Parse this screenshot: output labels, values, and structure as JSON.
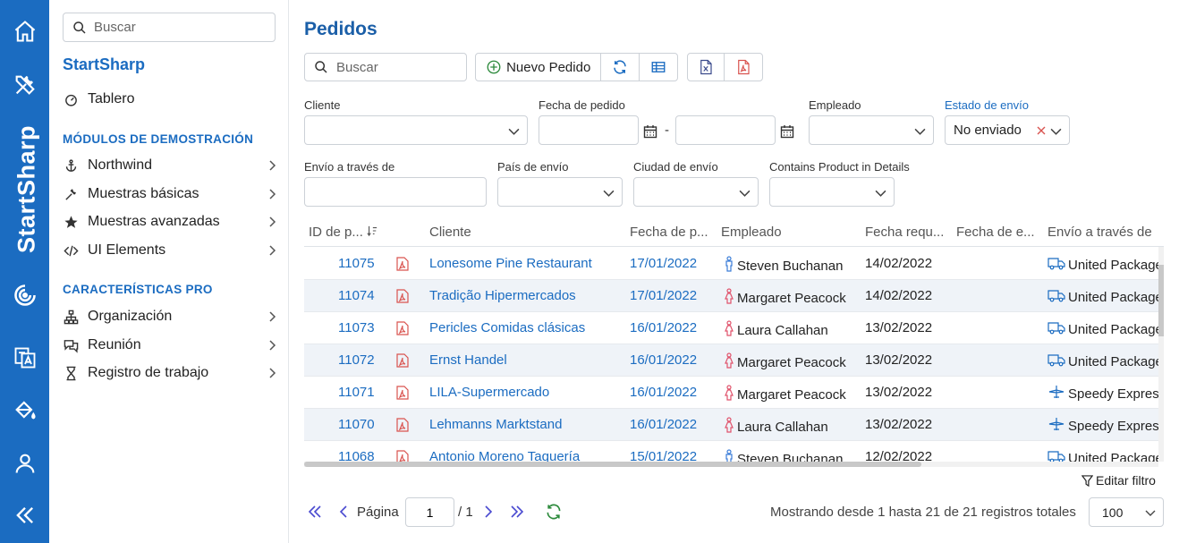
{
  "rail": {
    "brand": "StartSharp",
    "items": [
      "home-icon",
      "tools-icon",
      "logo-icon",
      "translate-icon",
      "paint-bucket-icon",
      "user-icon",
      "collapse-icon"
    ]
  },
  "sidebar": {
    "search_placeholder": "Buscar",
    "brand": "StartSharp",
    "dashboard": "Tablero",
    "section_demo": "MÓDULOS DE DEMOSTRACIÓN",
    "demo_items": [
      "Northwind",
      "Muestras básicas",
      "Muestras avanzadas",
      "UI Elements"
    ],
    "section_pro": "CARACTERÍSTICAS PRO",
    "pro_items": [
      "Organización",
      "Reunión",
      "Registro de trabajo"
    ]
  },
  "main": {
    "title": "Pedidos",
    "search_placeholder": "Buscar",
    "new_order": "Nuevo Pedido"
  },
  "filters": {
    "customer_label": "Cliente",
    "order_date_label": "Fecha de pedido",
    "date_sep": "-",
    "employee_label": "Empleado",
    "ship_status_label": "Estado de envío",
    "ship_status_value": "No enviado",
    "ship_via_label": "Envío a través de",
    "ship_country_label": "País de envío",
    "ship_city_label": "Ciudad de envío",
    "contains_product_label": "Contains Product in Details"
  },
  "grid": {
    "headers": [
      "ID de p...",
      "Cliente",
      "Fecha de p...",
      "Empleado",
      "Fecha requ...",
      "Fecha de e...",
      "Envío a través de"
    ],
    "rows": [
      {
        "id": "11075",
        "customer": "Lonesome Pine Restaurant",
        "date": "17/01/2022",
        "employee": "Steven Buchanan",
        "gender": "male",
        "required": "14/02/2022",
        "shipped": "",
        "ship_via": "United Package",
        "ship_icon": "truck-icon"
      },
      {
        "id": "11074",
        "customer": "Tradição Hipermercados",
        "date": "17/01/2022",
        "employee": "Margaret Peacock",
        "gender": "female",
        "required": "14/02/2022",
        "shipped": "",
        "ship_via": "United Package",
        "ship_icon": "truck-icon"
      },
      {
        "id": "11073",
        "customer": "Pericles Comidas clásicas",
        "date": "16/01/2022",
        "employee": "Laura Callahan",
        "gender": "female",
        "required": "13/02/2022",
        "shipped": "",
        "ship_via": "United Package",
        "ship_icon": "truck-icon"
      },
      {
        "id": "11072",
        "customer": "Ernst Handel",
        "date": "16/01/2022",
        "employee": "Margaret Peacock",
        "gender": "female",
        "required": "13/02/2022",
        "shipped": "",
        "ship_via": "United Package",
        "ship_icon": "truck-icon"
      },
      {
        "id": "11071",
        "customer": "LILA-Supermercado",
        "date": "16/01/2022",
        "employee": "Margaret Peacock",
        "gender": "female",
        "required": "13/02/2022",
        "shipped": "",
        "ship_via": "Speedy Express",
        "ship_icon": "plane-icon"
      },
      {
        "id": "11070",
        "customer": "Lehmanns Marktstand",
        "date": "16/01/2022",
        "employee": "Laura Callahan",
        "gender": "female",
        "required": "13/02/2022",
        "shipped": "",
        "ship_via": "Speedy Express",
        "ship_icon": "plane-icon"
      },
      {
        "id": "11068",
        "customer": "Antonio Moreno Taquería",
        "date": "15/01/2022",
        "employee": "Steven Buchanan",
        "gender": "male",
        "required": "12/02/2022",
        "shipped": "",
        "ship_via": "United Package",
        "ship_icon": "truck-icon"
      }
    ]
  },
  "edit_filter": "Editar filtro",
  "pager": {
    "page_label": "Página",
    "page_value": "1",
    "page_total": "/ 1",
    "info": "Mostrando desde 1 hasta 21 de 21 registros totales",
    "page_size": "100"
  },
  "colors": {
    "primary": "#1b6cc1",
    "pdf": "#d9534f",
    "female": "#e0526b",
    "male": "#3b7dd8"
  }
}
